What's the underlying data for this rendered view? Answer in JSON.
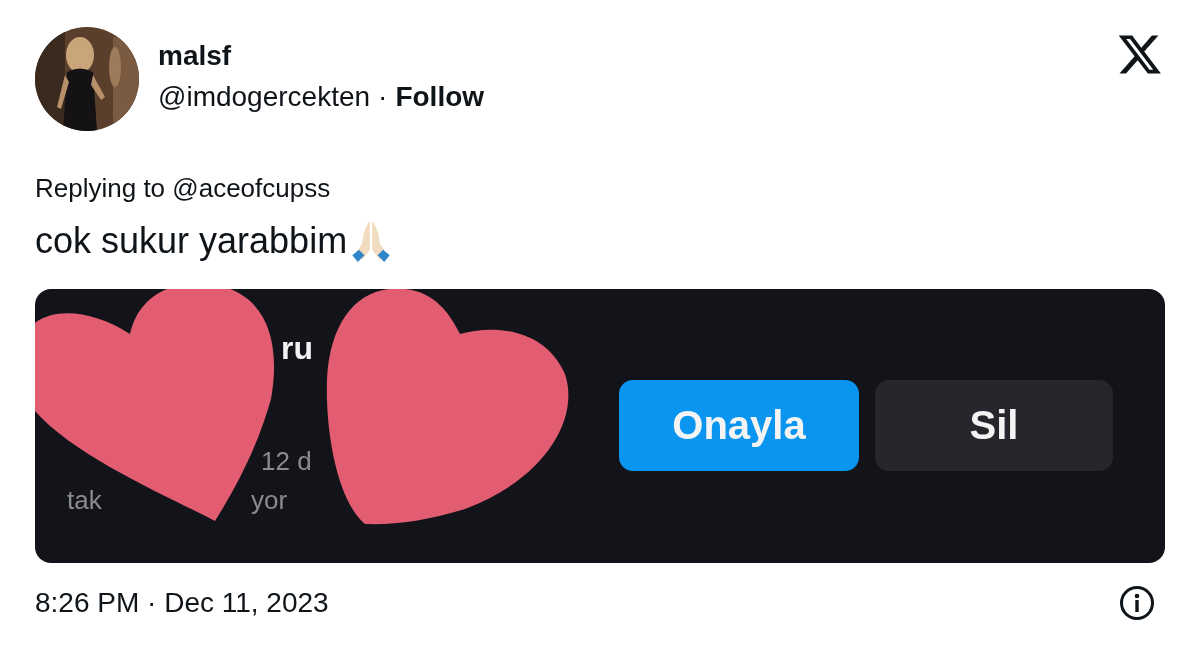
{
  "author": {
    "name": "malsf",
    "handle": "@imdogercekten",
    "separator": "·",
    "follow": "Follow"
  },
  "reply_to": "Replying to @aceofcupss",
  "text": "cok sukur yarabbim",
  "attachment": {
    "fragments": [
      {
        "kind": "title",
        "text": "ru"
      },
      {
        "kind": "meta",
        "text": "12 d"
      },
      {
        "kind": "meta",
        "text": "tak"
      },
      {
        "kind": "meta",
        "text": "yor"
      }
    ],
    "buttons": [
      {
        "label": "Onayla",
        "kind": "primary"
      },
      {
        "label": "Sil",
        "kind": "secondary"
      }
    ]
  },
  "timestamp": "8:26 PM · Dec 11, 2023"
}
